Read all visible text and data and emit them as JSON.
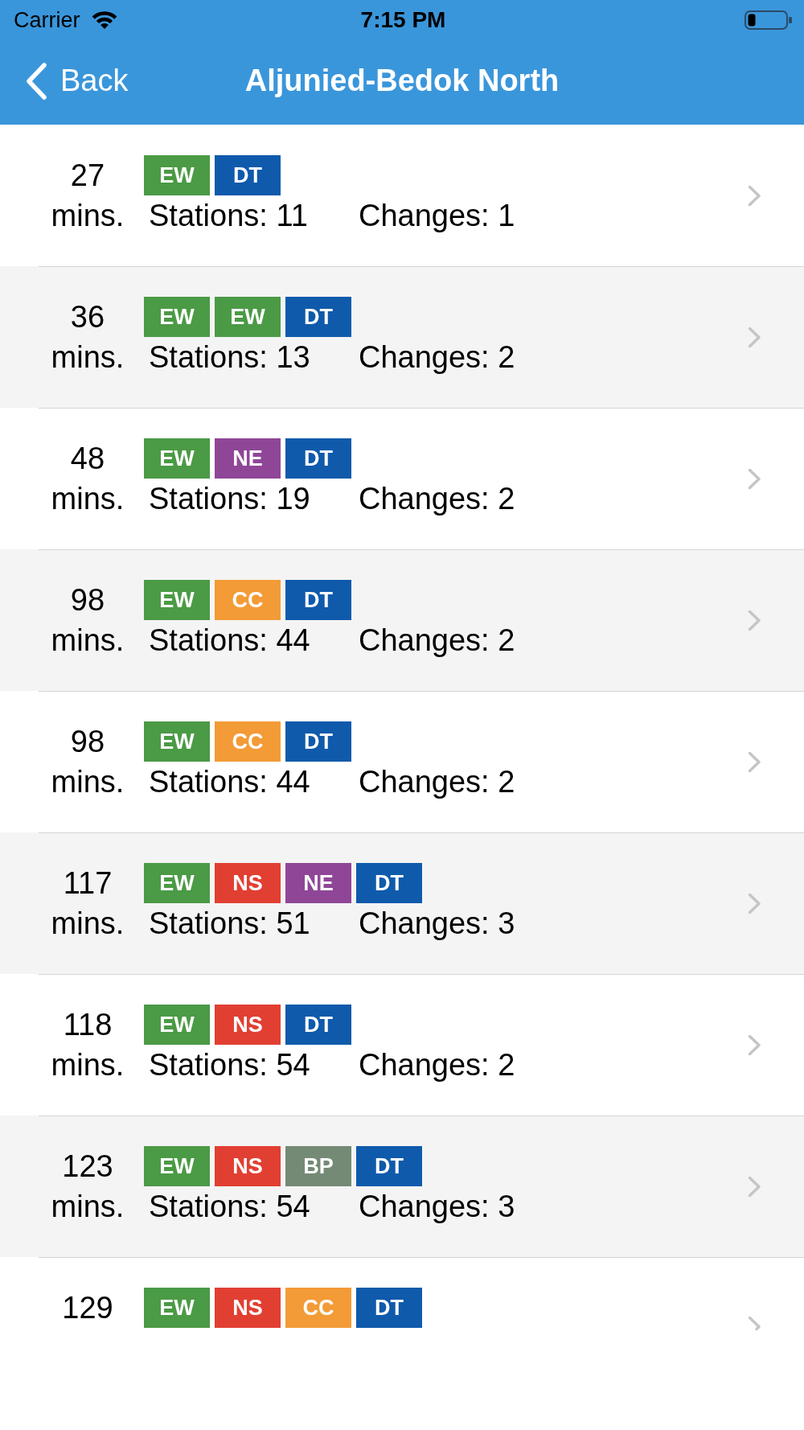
{
  "status_bar": {
    "carrier": "Carrier",
    "time": "7:15 PM"
  },
  "nav": {
    "back": "Back",
    "title": "Aljunied-Bedok North"
  },
  "routes": [
    {
      "minutes": "27",
      "unit": "mins.",
      "lines": [
        {
          "code": "EW",
          "color": "#4b9a45"
        },
        {
          "code": "DT",
          "color": "#0f5aab"
        }
      ],
      "stations": "Stations: 11",
      "changes": "Changes: 1",
      "cut": false
    },
    {
      "minutes": "36",
      "unit": "mins.",
      "lines": [
        {
          "code": "EW",
          "color": "#4b9a45"
        },
        {
          "code": "EW",
          "color": "#4b9a45"
        },
        {
          "code": "DT",
          "color": "#0f5aab"
        }
      ],
      "stations": "Stations: 13",
      "changes": "Changes: 2",
      "cut": false
    },
    {
      "minutes": "48",
      "unit": "mins.",
      "lines": [
        {
          "code": "EW",
          "color": "#4b9a45"
        },
        {
          "code": "NE",
          "color": "#8f4697"
        },
        {
          "code": "DT",
          "color": "#0f5aab"
        }
      ],
      "stations": "Stations: 19",
      "changes": "Changes: 2",
      "cut": false
    },
    {
      "minutes": "98",
      "unit": "mins.",
      "lines": [
        {
          "code": "EW",
          "color": "#4b9a45"
        },
        {
          "code": "CC",
          "color": "#f39b36"
        },
        {
          "code": "DT",
          "color": "#0f5aab"
        }
      ],
      "stations": "Stations: 44",
      "changes": "Changes: 2",
      "cut": false
    },
    {
      "minutes": "98",
      "unit": "mins.",
      "lines": [
        {
          "code": "EW",
          "color": "#4b9a45"
        },
        {
          "code": "CC",
          "color": "#f39b36"
        },
        {
          "code": "DT",
          "color": "#0f5aab"
        }
      ],
      "stations": "Stations: 44",
      "changes": "Changes: 2",
      "cut": false
    },
    {
      "minutes": "117",
      "unit": "mins.",
      "lines": [
        {
          "code": "EW",
          "color": "#4b9a45"
        },
        {
          "code": "NS",
          "color": "#e13f32"
        },
        {
          "code": "NE",
          "color": "#8f4697"
        },
        {
          "code": "DT",
          "color": "#0f5aab"
        }
      ],
      "stations": "Stations: 51",
      "changes": "Changes: 3",
      "cut": false
    },
    {
      "minutes": "118",
      "unit": "mins.",
      "lines": [
        {
          "code": "EW",
          "color": "#4b9a45"
        },
        {
          "code": "NS",
          "color": "#e13f32"
        },
        {
          "code": "DT",
          "color": "#0f5aab"
        }
      ],
      "stations": "Stations: 54",
      "changes": "Changes: 2",
      "cut": false
    },
    {
      "minutes": "123",
      "unit": "mins.",
      "lines": [
        {
          "code": "EW",
          "color": "#4b9a45"
        },
        {
          "code": "NS",
          "color": "#e13f32"
        },
        {
          "code": "BP",
          "color": "#748a75"
        },
        {
          "code": "DT",
          "color": "#0f5aab"
        }
      ],
      "stations": "Stations: 54",
      "changes": "Changes: 3",
      "cut": false
    },
    {
      "minutes": "129",
      "lines": [
        {
          "code": "EW",
          "color": "#4b9a45"
        },
        {
          "code": "NS",
          "color": "#e13f32"
        },
        {
          "code": "CC",
          "color": "#f39b36"
        },
        {
          "code": "DT",
          "color": "#0f5aab"
        }
      ],
      "cut": true
    }
  ]
}
